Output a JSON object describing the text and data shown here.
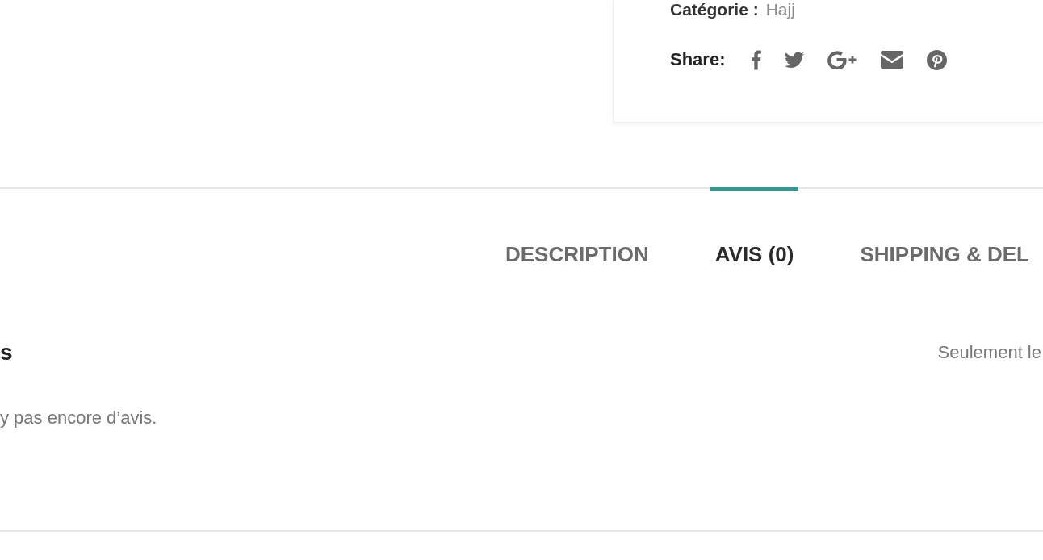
{
  "product_meta": {
    "category_label": "Catégorie :",
    "category_value": "Hajj",
    "share_label": "Share:"
  },
  "tabs": [
    {
      "label": "DESCRIPTION",
      "selected": false
    },
    {
      "label": "AVIS (0)",
      "selected": true
    },
    {
      "label": "SHIPPING & DEL",
      "selected": false
    }
  ],
  "reviews": {
    "heading": "s",
    "empty_message": "y pas encore d’avis.",
    "notice": "Seulement le"
  }
}
